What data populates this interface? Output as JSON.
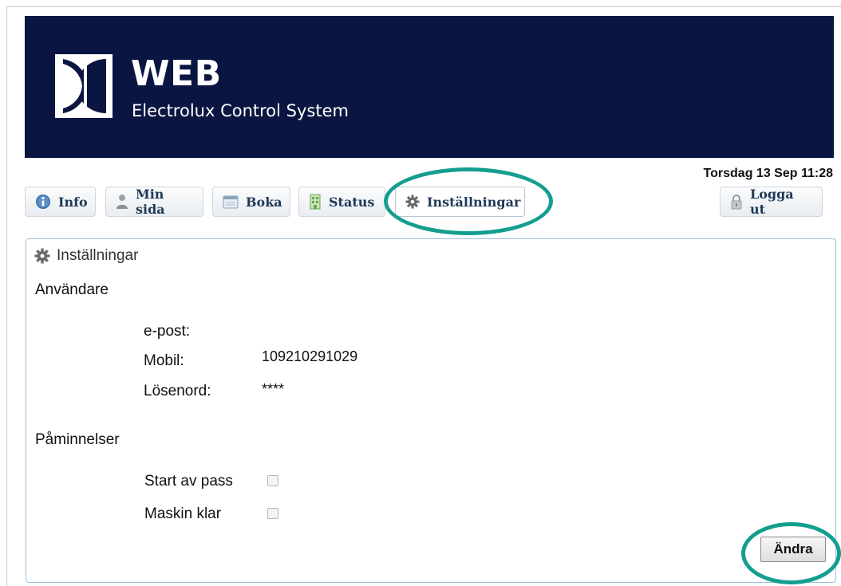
{
  "brand": {
    "title": "WEB",
    "subtitle": "Electrolux Control System",
    "logo_icon": "electrolux-logo-icon"
  },
  "datetime": "Torsdag 13 Sep 11:28",
  "nav": {
    "tabs": [
      {
        "label": "Info",
        "icon": "info-icon"
      },
      {
        "label": "Min sida",
        "icon": "person-icon"
      },
      {
        "label": "Boka",
        "icon": "calendar-icon"
      },
      {
        "label": "Status",
        "icon": "building-icon"
      },
      {
        "label": "Inställningar",
        "icon": "gear-icon",
        "active": true
      }
    ],
    "logout": {
      "label": "Logga ut",
      "icon": "lock-icon"
    }
  },
  "panel": {
    "title": "Inställningar",
    "icon": "gear-icon",
    "user_section": {
      "title": "Användare",
      "fields": [
        {
          "label": "e-post:",
          "value": ""
        },
        {
          "label": "Mobil:",
          "value": "109210291029"
        },
        {
          "label": "Lösenord:",
          "value": "****"
        }
      ]
    },
    "reminders_section": {
      "title": "Påminnelser",
      "options": [
        {
          "label": "Start av pass",
          "checked": false
        },
        {
          "label": "Maskin klar",
          "checked": false
        }
      ]
    },
    "edit_button": "Ändra"
  },
  "colors": {
    "banner_bg": "#0b1541",
    "highlight": "#149e90",
    "panel_border": "#9bbfdc",
    "tab_text": "#1f3a57"
  }
}
